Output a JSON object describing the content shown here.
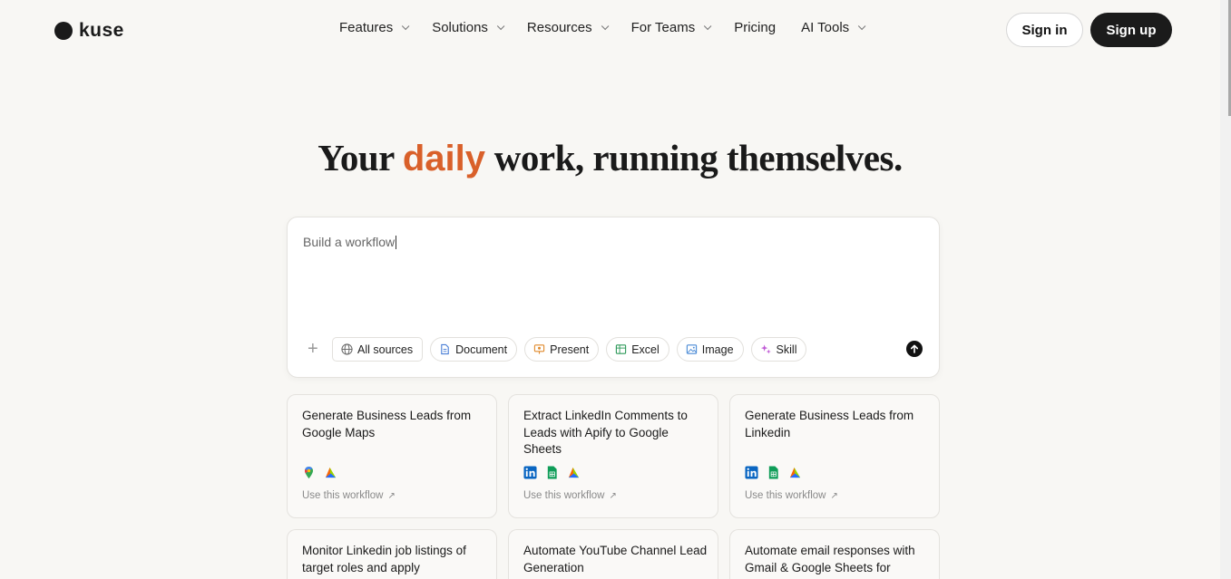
{
  "brand": {
    "name": "kuse"
  },
  "nav": {
    "items": [
      {
        "label": "Features",
        "dropdown": true
      },
      {
        "label": "Solutions",
        "dropdown": true
      },
      {
        "label": "Resources",
        "dropdown": true
      },
      {
        "label": "For Teams",
        "dropdown": true
      },
      {
        "label": "Pricing",
        "dropdown": false
      },
      {
        "label": "AI Tools",
        "dropdown": true
      }
    ],
    "signin_label": "Sign in",
    "signup_label": "Sign up"
  },
  "hero": {
    "title_before": "Your ",
    "title_accent": "daily",
    "title_after": " work, running themselves.",
    "accent_color": "#d9602a"
  },
  "prompt": {
    "value": "Build a workflow",
    "chips": [
      {
        "label": "All sources",
        "icon": "globe-icon"
      },
      {
        "label": "Document",
        "icon": "document-icon"
      },
      {
        "label": "Present",
        "icon": "presentation-icon"
      },
      {
        "label": "Excel",
        "icon": "spreadsheet-icon"
      },
      {
        "label": "Image",
        "icon": "image-icon"
      },
      {
        "label": "Skill",
        "icon": "skill-icon"
      }
    ]
  },
  "cards": [
    {
      "title": "Generate Business Leads from Google Maps",
      "icons": [
        "google-maps-icon",
        "apify-icon"
      ],
      "link": "Use this workflow"
    },
    {
      "title": "Extract LinkedIn Comments to Leads with Apify to Google Sheets",
      "icons": [
        "linkedin-icon",
        "google-sheets-icon",
        "apify-icon"
      ],
      "link": "Use this workflow"
    },
    {
      "title": "Generate Business Leads from Linkedin",
      "icons": [
        "linkedin-icon",
        "google-sheets-icon",
        "apify-icon"
      ],
      "link": "Use this workflow"
    },
    {
      "title": "Monitor Linkedin job listings of target roles and apply",
      "icons": [],
      "link": ""
    },
    {
      "title": "Automate YouTube Channel Lead Generation",
      "icons": [],
      "link": ""
    },
    {
      "title": "Automate email responses with Gmail & Google Sheets for",
      "icons": [],
      "link": ""
    }
  ]
}
